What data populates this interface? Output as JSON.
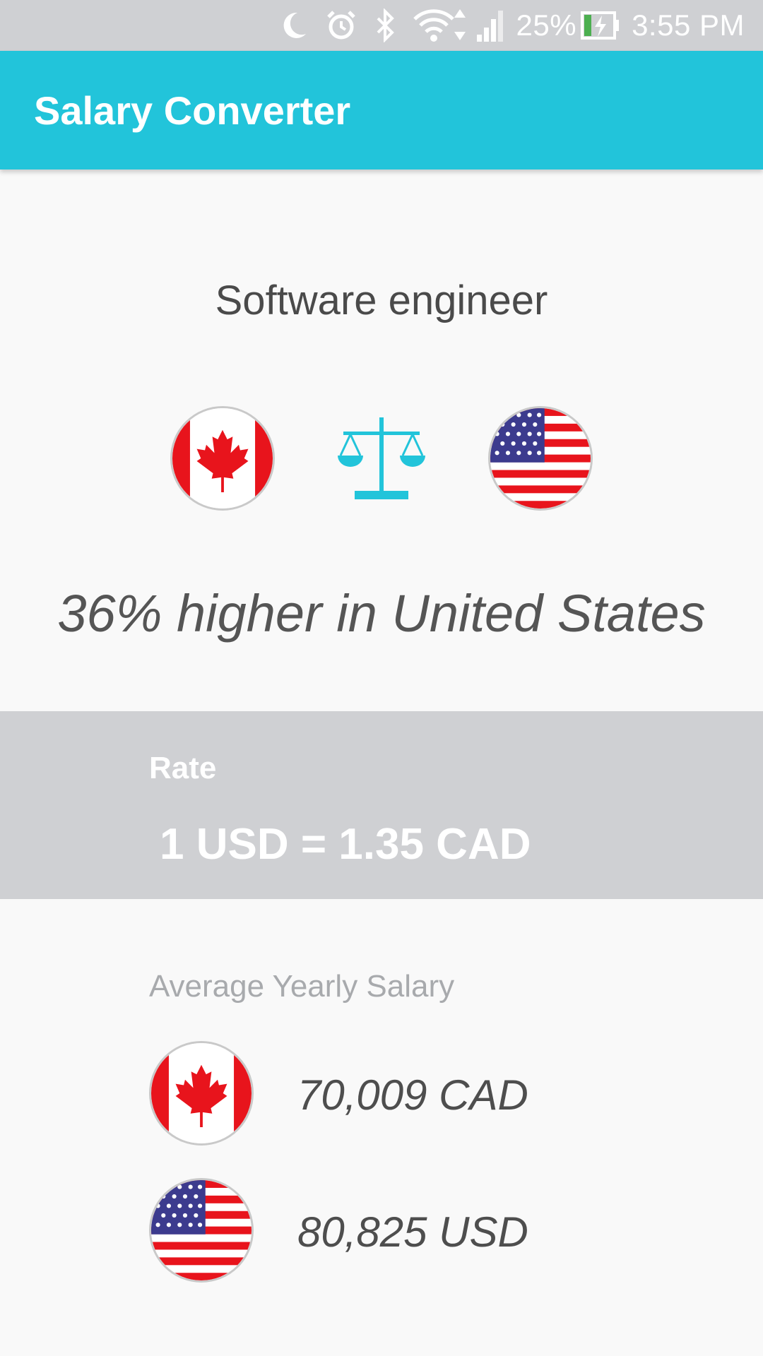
{
  "status_bar": {
    "battery": "25%",
    "time": "3:55 PM",
    "icons": [
      "moon-icon",
      "alarm-icon",
      "bluetooth-icon",
      "wifi-icon",
      "signal-icon",
      "battery-charging-icon"
    ]
  },
  "app_bar": {
    "title": "Salary Converter"
  },
  "comparison": {
    "job_title": "Software engineer",
    "left_country_icon": "canada-flag-icon",
    "center_icon": "balance-scale-icon",
    "right_country_icon": "us-flag-icon",
    "headline": "36% higher in United States"
  },
  "rate": {
    "label": "Rate",
    "value": "1 USD = 1.35 CAD"
  },
  "salary": {
    "label": "Average Yearly Salary",
    "rows": [
      {
        "flag": "canada-flag-icon",
        "amount": "70,009 CAD"
      },
      {
        "flag": "us-flag-icon",
        "amount": "80,825 USD"
      }
    ]
  },
  "colors": {
    "accent": "#22c4da",
    "status_bar": "#cfd0d3",
    "panel": "#cfd0d3",
    "background": "#f9f9f9",
    "flag_red": "#e8141c",
    "us_blue": "#3c3b8e"
  }
}
